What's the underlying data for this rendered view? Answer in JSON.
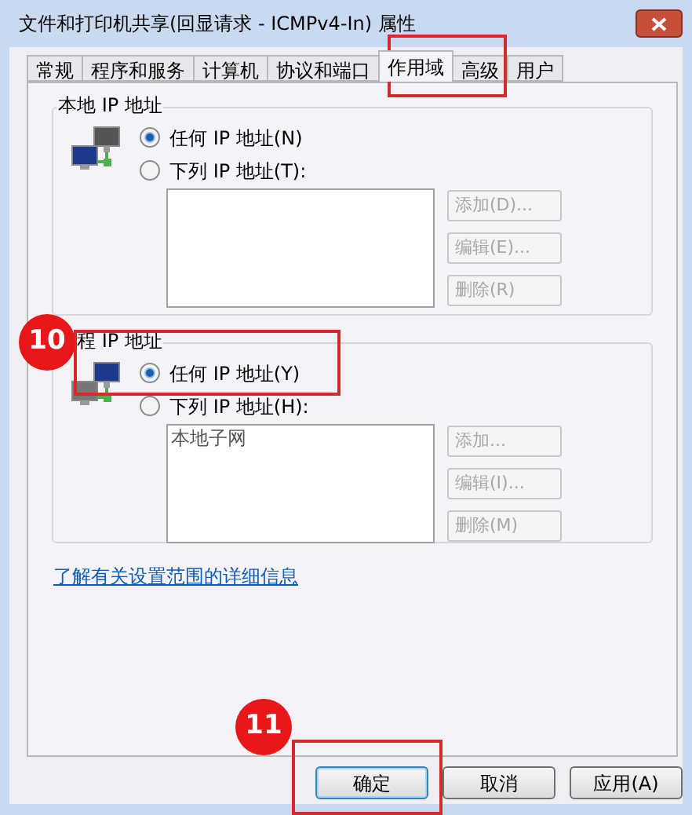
{
  "window": {
    "title": "文件和打印机共享(回显请求 - ICMPv4-In) 属性"
  },
  "tabs": [
    {
      "label": "常规",
      "selected": false
    },
    {
      "label": "程序和服务",
      "selected": false
    },
    {
      "label": "计算机",
      "selected": false
    },
    {
      "label": "协议和端口",
      "selected": false
    },
    {
      "label": "作用域",
      "selected": true
    },
    {
      "label": "高级",
      "selected": false
    },
    {
      "label": "用户",
      "selected": false
    }
  ],
  "groups": [
    {
      "title": "本地 IP 地址",
      "options": [
        {
          "label": "任何 IP 地址(N)",
          "selected": true
        },
        {
          "label": "下列 IP 地址(T):",
          "selected": false
        }
      ],
      "buttons": [
        {
          "label": "添加(D)...",
          "disabled": true
        },
        {
          "label": "编辑(E)...",
          "disabled": true
        },
        {
          "label": "删除(R)",
          "disabled": true
        }
      ]
    },
    {
      "title": "程 IP 地址",
      "options": [
        {
          "label": "任何 IP 地址(Y)",
          "selected": true
        },
        {
          "label": "下列 IP 地址(H):",
          "selected": false
        }
      ],
      "list_items": [
        "本地子网"
      ],
      "buttons": [
        {
          "label": "添加...",
          "disabled": true
        },
        {
          "label": "编辑(I)...",
          "disabled": true
        },
        {
          "label": "删除(M)",
          "disabled": true
        }
      ]
    }
  ],
  "link": "了解有关设置范围的详细信息",
  "buttons": [
    {
      "label": "确定",
      "default": true
    },
    {
      "label": "取消",
      "default": false
    },
    {
      "label": "应用(A)",
      "default": false
    }
  ],
  "annotations": [
    {
      "label": "10"
    },
    {
      "label": "11"
    }
  ]
}
